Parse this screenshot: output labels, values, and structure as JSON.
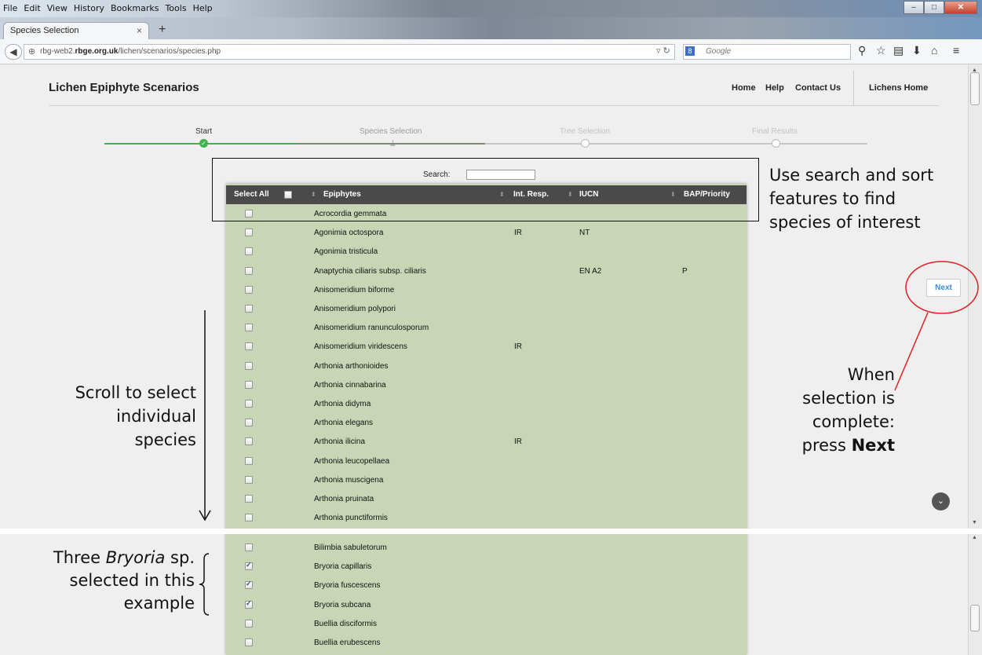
{
  "browser": {
    "menu": [
      "File",
      "Edit",
      "View",
      "History",
      "Bookmarks",
      "Tools",
      "Help"
    ],
    "tab_title": "Species Selection",
    "tab_close": "×",
    "new_tab": "+",
    "url_prefix": "rbg-web2.",
    "url_host": "rbge.org.uk",
    "url_path": "/lichen/scenarios/species.php",
    "search_placeholder": "Google"
  },
  "header": {
    "site_title": "Lichen Epiphyte Scenarios",
    "nav": [
      "Home",
      "Help",
      "Contact Us"
    ],
    "lichens_home": "Lichens Home"
  },
  "steps": [
    {
      "label": "Start",
      "state": "done"
    },
    {
      "label": "Species Selection",
      "state": "current"
    },
    {
      "label": "Tree Selection",
      "state": "todo"
    },
    {
      "label": "Final Results",
      "state": "todo"
    }
  ],
  "table": {
    "search_label": "Search:",
    "columns": [
      "Select All",
      "Epiphytes",
      "Int. Resp.",
      "IUCN",
      "BAP/Priority"
    ],
    "rows_top": [
      {
        "name": "Acrocordia gemmata",
        "resp": "",
        "iucn": "",
        "bap": "",
        "checked": false
      },
      {
        "name": "Agonimia octospora",
        "resp": "IR",
        "iucn": "NT",
        "bap": "",
        "checked": false
      },
      {
        "name": "Agonimia tristicula",
        "resp": "",
        "iucn": "",
        "bap": "",
        "checked": false
      },
      {
        "name": "Anaptychia ciliaris subsp. ciliaris",
        "resp": "",
        "iucn": "EN A2",
        "bap": "P",
        "checked": false
      },
      {
        "name": "Anisomeridium biforme",
        "resp": "",
        "iucn": "",
        "bap": "",
        "checked": false
      },
      {
        "name": "Anisomeridium polypori",
        "resp": "",
        "iucn": "",
        "bap": "",
        "checked": false
      },
      {
        "name": "Anisomeridium ranunculosporum",
        "resp": "",
        "iucn": "",
        "bap": "",
        "checked": false
      },
      {
        "name": "Anisomeridium viridescens",
        "resp": "IR",
        "iucn": "",
        "bap": "",
        "checked": false
      },
      {
        "name": "Arthonia arthonioides",
        "resp": "",
        "iucn": "",
        "bap": "",
        "checked": false
      },
      {
        "name": "Arthonia cinnabarina",
        "resp": "",
        "iucn": "",
        "bap": "",
        "checked": false
      },
      {
        "name": "Arthonia didyma",
        "resp": "",
        "iucn": "",
        "bap": "",
        "checked": false
      },
      {
        "name": "Arthonia elegans",
        "resp": "",
        "iucn": "",
        "bap": "",
        "checked": false
      },
      {
        "name": "Arthonia ilicina",
        "resp": "IR",
        "iucn": "",
        "bap": "",
        "checked": false
      },
      {
        "name": "Arthonia leucopellaea",
        "resp": "",
        "iucn": "",
        "bap": "",
        "checked": false
      },
      {
        "name": "Arthonia muscigena",
        "resp": "",
        "iucn": "",
        "bap": "",
        "checked": false
      },
      {
        "name": "Arthonia pruinata",
        "resp": "",
        "iucn": "",
        "bap": "",
        "checked": false
      },
      {
        "name": "Arthonia punctiformis",
        "resp": "",
        "iucn": "",
        "bap": "",
        "checked": false
      }
    ],
    "rows_bottom": [
      {
        "name": "Bilimbia sabuletorum",
        "checked": false
      },
      {
        "name": "Bryoria capillaris",
        "checked": true
      },
      {
        "name": "Bryoria fuscescens",
        "checked": true
      },
      {
        "name": "Bryoria subcana",
        "checked": true
      },
      {
        "name": "Buellia disciformis",
        "checked": false
      },
      {
        "name": "Buellia erubescens",
        "checked": false
      }
    ]
  },
  "annotations": {
    "search_lines": [
      "Use search and sort",
      "features to find",
      "species of interest"
    ],
    "scroll_lines": [
      "Scroll to select",
      "individual",
      "species"
    ],
    "next_lines": [
      "When",
      "selection is",
      "complete:"
    ],
    "next_prefix": "press ",
    "next_bold": "Next",
    "bryoria_prefix": "Three ",
    "bryoria_italic": "Bryoria",
    "bryoria_suffix": " sp.",
    "bryoria_lines": [
      "selected in this",
      "example"
    ]
  },
  "buttons": {
    "next": "Next"
  },
  "colors": {
    "step_done": "#3cb44a",
    "table_bg": "#c8d6b6",
    "header_bg": "#4a4a4a",
    "next_text": "#3a8ed6",
    "annotation_red": "#e02020"
  }
}
